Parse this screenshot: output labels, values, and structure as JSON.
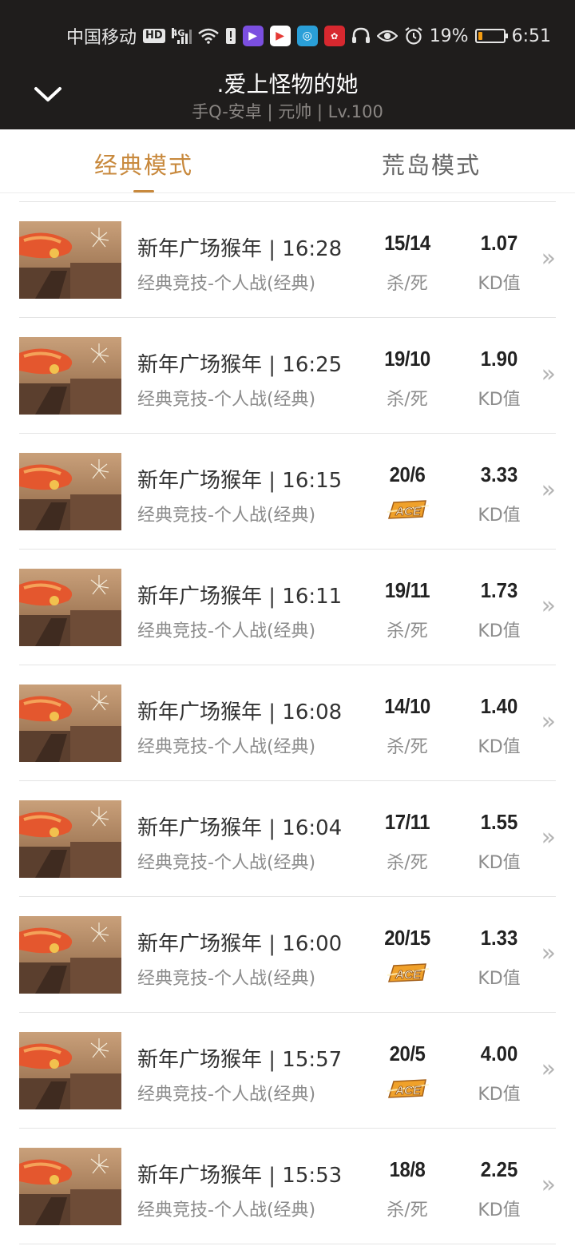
{
  "status_bar": {
    "carrier": "中国移动",
    "hd": "HD",
    "network": "4G",
    "battery_percent": "19%",
    "battery_level": 0.19,
    "time": "6:51"
  },
  "header": {
    "title": ".爱上怪物的她",
    "subtitle": "手Q-安卓 | 元帅 | Lv.100"
  },
  "tabs": [
    {
      "label": "经典模式",
      "active": true
    },
    {
      "label": "荒岛模式",
      "active": false
    }
  ],
  "matches": [
    {
      "title": "新年广场猴年 | 16:28",
      "mode": "经典竞技-个人战(经典)",
      "kills_deaths": "15/14",
      "kd_label": "杀/死",
      "ace": false,
      "kd_ratio": "1.07",
      "ratio_label": "KD值"
    },
    {
      "title": "新年广场猴年 | 16:25",
      "mode": "经典竞技-个人战(经典)",
      "kills_deaths": "19/10",
      "kd_label": "杀/死",
      "ace": false,
      "kd_ratio": "1.90",
      "ratio_label": "KD值"
    },
    {
      "title": "新年广场猴年 | 16:15",
      "mode": "经典竞技-个人战(经典)",
      "kills_deaths": "20/6",
      "kd_label": "",
      "ace": true,
      "kd_ratio": "3.33",
      "ratio_label": "KD值"
    },
    {
      "title": "新年广场猴年 | 16:11",
      "mode": "经典竞技-个人战(经典)",
      "kills_deaths": "19/11",
      "kd_label": "杀/死",
      "ace": false,
      "kd_ratio": "1.73",
      "ratio_label": "KD值"
    },
    {
      "title": "新年广场猴年 | 16:08",
      "mode": "经典竞技-个人战(经典)",
      "kills_deaths": "14/10",
      "kd_label": "杀/死",
      "ace": false,
      "kd_ratio": "1.40",
      "ratio_label": "KD值"
    },
    {
      "title": "新年广场猴年 | 16:04",
      "mode": "经典竞技-个人战(经典)",
      "kills_deaths": "17/11",
      "kd_label": "杀/死",
      "ace": false,
      "kd_ratio": "1.55",
      "ratio_label": "KD值"
    },
    {
      "title": "新年广场猴年 | 16:00",
      "mode": "经典竞技-个人战(经典)",
      "kills_deaths": "20/15",
      "kd_label": "",
      "ace": true,
      "kd_ratio": "1.33",
      "ratio_label": "KD值"
    },
    {
      "title": "新年广场猴年 | 15:57",
      "mode": "经典竞技-个人战(经典)",
      "kills_deaths": "20/5",
      "kd_label": "",
      "ace": true,
      "kd_ratio": "4.00",
      "ratio_label": "KD值"
    },
    {
      "title": "新年广场猴年 | 15:53",
      "mode": "经典竞技-个人战(经典)",
      "kills_deaths": "18/8",
      "kd_label": "杀/死",
      "ace": false,
      "kd_ratio": "2.25",
      "ratio_label": "KD值"
    }
  ],
  "colors": {
    "accent": "#c8893d",
    "header_bg": "#1f1d1c",
    "battery": "#f39c12"
  },
  "icons": {
    "back": "chevron-down-icon",
    "row_arrow": "double-chevron-right-icon",
    "ace_badge": "ace-badge-icon"
  }
}
